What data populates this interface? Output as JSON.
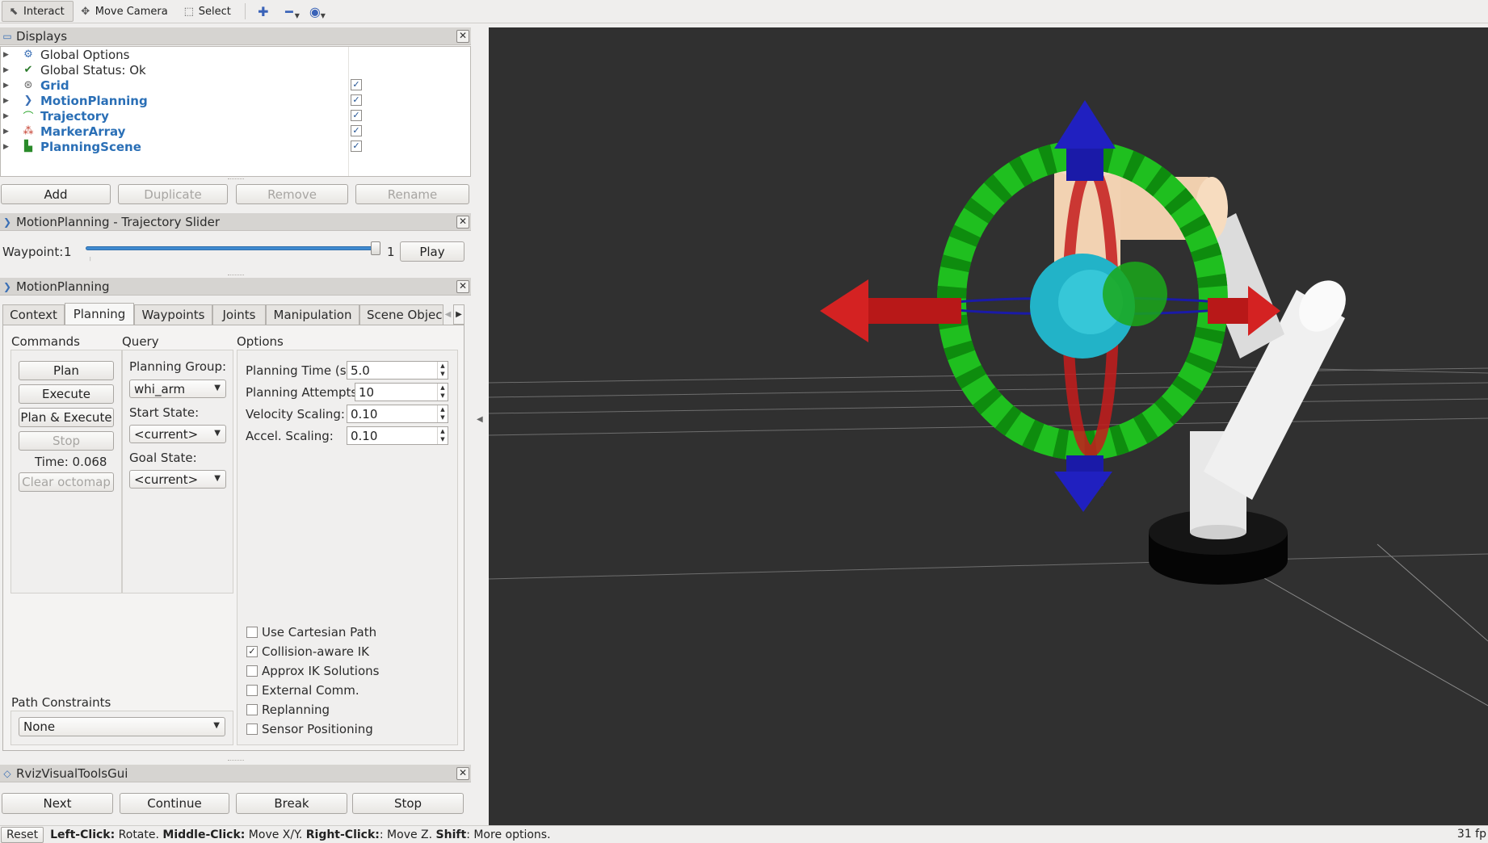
{
  "toolbar": {
    "interact": "Interact",
    "move_camera": "Move Camera",
    "select": "Select",
    "icons": [
      "cursor-icon",
      "camera-move-icon",
      "select-box-icon",
      "add-tool-icon",
      "remove-tool-icon",
      "eye-icon"
    ]
  },
  "displays": {
    "title": "Displays",
    "items": [
      {
        "label": "Global Options",
        "icon": "gear-icon",
        "checked": null
      },
      {
        "label": "Global Status: Ok",
        "icon": "check-icon",
        "checked": null
      },
      {
        "label": "Grid",
        "icon": "grid-icon",
        "checked": true
      },
      {
        "label": "MotionPlanning",
        "icon": "motion-planning-icon",
        "checked": true
      },
      {
        "label": "Trajectory",
        "icon": "trajectory-icon",
        "checked": true
      },
      {
        "label": "MarkerArray",
        "icon": "marker-array-icon",
        "checked": true
      },
      {
        "label": "PlanningScene",
        "icon": "planning-scene-icon",
        "checked": true
      }
    ],
    "buttons": {
      "add": "Add",
      "duplicate": "Duplicate",
      "remove": "Remove",
      "rename": "Rename"
    }
  },
  "slider_panel": {
    "title": "MotionPlanning - Trajectory Slider",
    "waypoint_label": "Waypoint:",
    "waypoint_value": "1",
    "max_value": "1",
    "play": "Play",
    "position_fraction": 1.0
  },
  "motion_planning": {
    "title": "MotionPlanning",
    "tabs": [
      "Context",
      "Planning",
      "Waypoints",
      "Joints",
      "Manipulation",
      "Scene Object"
    ],
    "active_tab": "Planning",
    "commands": {
      "label": "Commands",
      "plan": "Plan",
      "execute": "Execute",
      "plan_execute": "Plan & Execute",
      "stop": "Stop",
      "time": "Time: 0.068",
      "clear_octomap": "Clear octomap"
    },
    "query": {
      "label": "Query",
      "planning_group_label": "Planning Group:",
      "planning_group": "whi_arm",
      "start_state_label": "Start State:",
      "start_state": "<current>",
      "goal_state_label": "Goal State:",
      "goal_state": "<current>"
    },
    "options": {
      "label": "Options",
      "planning_time_label": "Planning Time (s):",
      "planning_time": "5.0",
      "planning_attempts_label": "Planning Attempts:",
      "planning_attempts": "10",
      "velocity_scaling_label": "Velocity Scaling:",
      "velocity_scaling": "0.10",
      "accel_scaling_label": "Accel. Scaling:",
      "accel_scaling": "0.10",
      "checkboxes": [
        {
          "label": "Use Cartesian Path",
          "checked": false
        },
        {
          "label": "Collision-aware IK",
          "checked": true
        },
        {
          "label": "Approx IK Solutions",
          "checked": false
        },
        {
          "label": "External Comm.",
          "checked": false
        },
        {
          "label": "Replanning",
          "checked": false
        },
        {
          "label": "Sensor Positioning",
          "checked": false
        }
      ]
    },
    "path_constraints": {
      "label": "Path Constraints",
      "value": "None"
    }
  },
  "rviz_visual_tools": {
    "title": "RvizVisualToolsGui",
    "next": "Next",
    "continue": "Continue",
    "break": "Break",
    "stop": "Stop"
  },
  "status_bar": {
    "reset": "Reset",
    "left_click": "Left-Click:",
    "left_click_desc": " Rotate. ",
    "middle_click": "Middle-Click:",
    "middle_click_desc": " Move X/Y. ",
    "right_click": "Right-Click:",
    "right_click_desc": ": Move Z. ",
    "shift": "Shift",
    "shift_desc": ": More options.",
    "fps": "31 fp"
  },
  "colors": {
    "link_blue": "#2a6fb6",
    "viewport_bg": "#303030",
    "ring_green": "#1fbf1f",
    "arrow_red": "#c41c1c",
    "arrow_blue": "#1a1aa8",
    "sphere_cyan": "#22b3c8",
    "link_peach": "#f0cfae"
  }
}
